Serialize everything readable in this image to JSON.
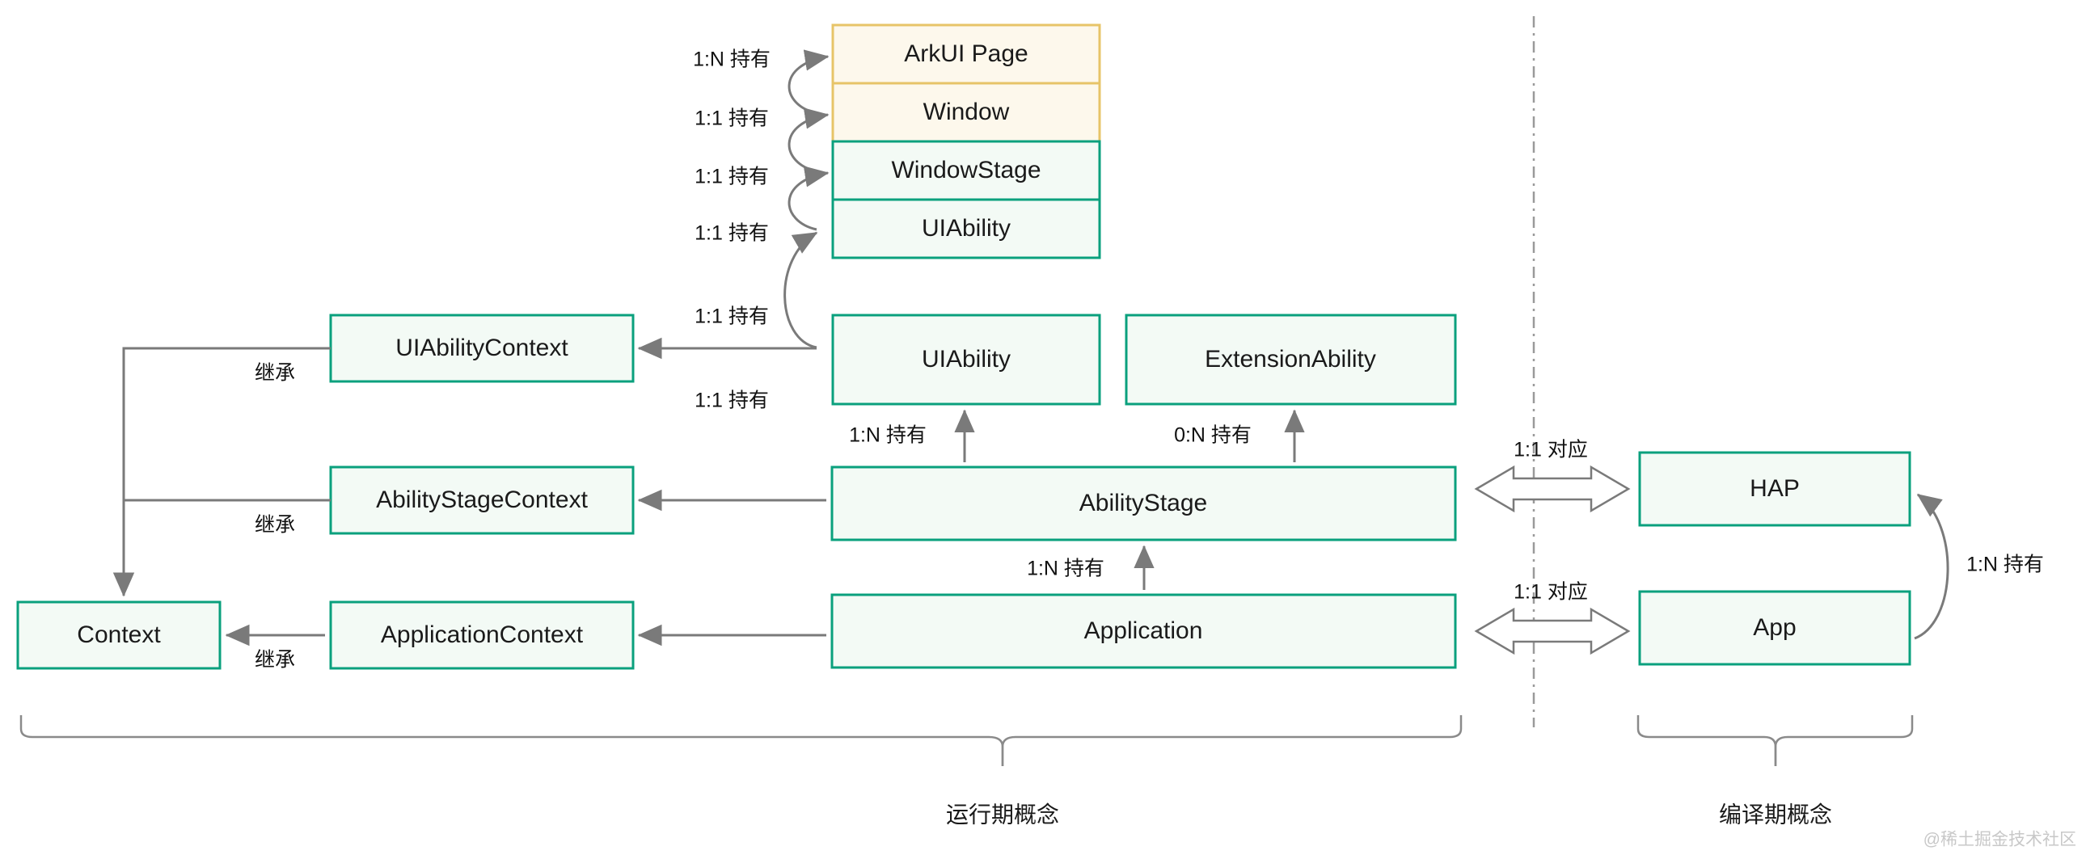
{
  "title": "HarmonyOS Stage model concepts diagram",
  "colors": {
    "green_border": "#0aa07d",
    "green_fill": "#f3faf5",
    "yellow_border": "#e7c468",
    "yellow_fill": "#fdf8ec",
    "line": "#7a7a7a",
    "text": "#1a1a1a",
    "watermark": "#c8c8c8"
  },
  "boxes": {
    "arkui_page": {
      "label": "ArkUI Page",
      "style": "yellow"
    },
    "window": {
      "label": "Window",
      "style": "yellow"
    },
    "window_stage": {
      "label": "WindowStage",
      "style": "green"
    },
    "ui_ability": {
      "label": "UIAbility",
      "style": "green"
    },
    "extension_ability": {
      "label": "ExtensionAbility",
      "style": "green"
    },
    "ui_ability_context": {
      "label": "UIAbilityContext",
      "style": "green"
    },
    "ability_stage_context": {
      "label": "AbilityStageContext",
      "style": "green"
    },
    "application_context": {
      "label": "ApplicationContext",
      "style": "green"
    },
    "context": {
      "label": "Context",
      "style": "green"
    },
    "ability_stage": {
      "label": "AbilityStage",
      "style": "green"
    },
    "application": {
      "label": "Application",
      "style": "green"
    },
    "hap": {
      "label": "HAP",
      "style": "green"
    },
    "app": {
      "label": "App",
      "style": "green"
    }
  },
  "edge_labels": {
    "page_to_window": "1:N 持有",
    "window_to_stage": "1:1 持有",
    "stage_to_ability": "1:1 持有",
    "ability_to_context": "1:1 持有",
    "abilitystage_to_uiability": "1:N 持有",
    "abilitystage_to_extension": "0:N 持有",
    "abilitystage_to_context": "1:1 持有",
    "application_to_abilitystage": "1:N 持有",
    "application_to_appcontext": "1:1 持有",
    "uiabilitycontext_inherit": "继承",
    "abilitystagecontext_inherit": "继承",
    "applicationcontext_inherit": "继承",
    "hap_correspond": "1:1 对应",
    "app_correspond": "1:1 对应",
    "app_to_hap": "1:N 持有"
  },
  "captions": {
    "runtime": "运行期概念",
    "compile": "编译期概念"
  },
  "watermark": "@稀土掘金技术社区"
}
